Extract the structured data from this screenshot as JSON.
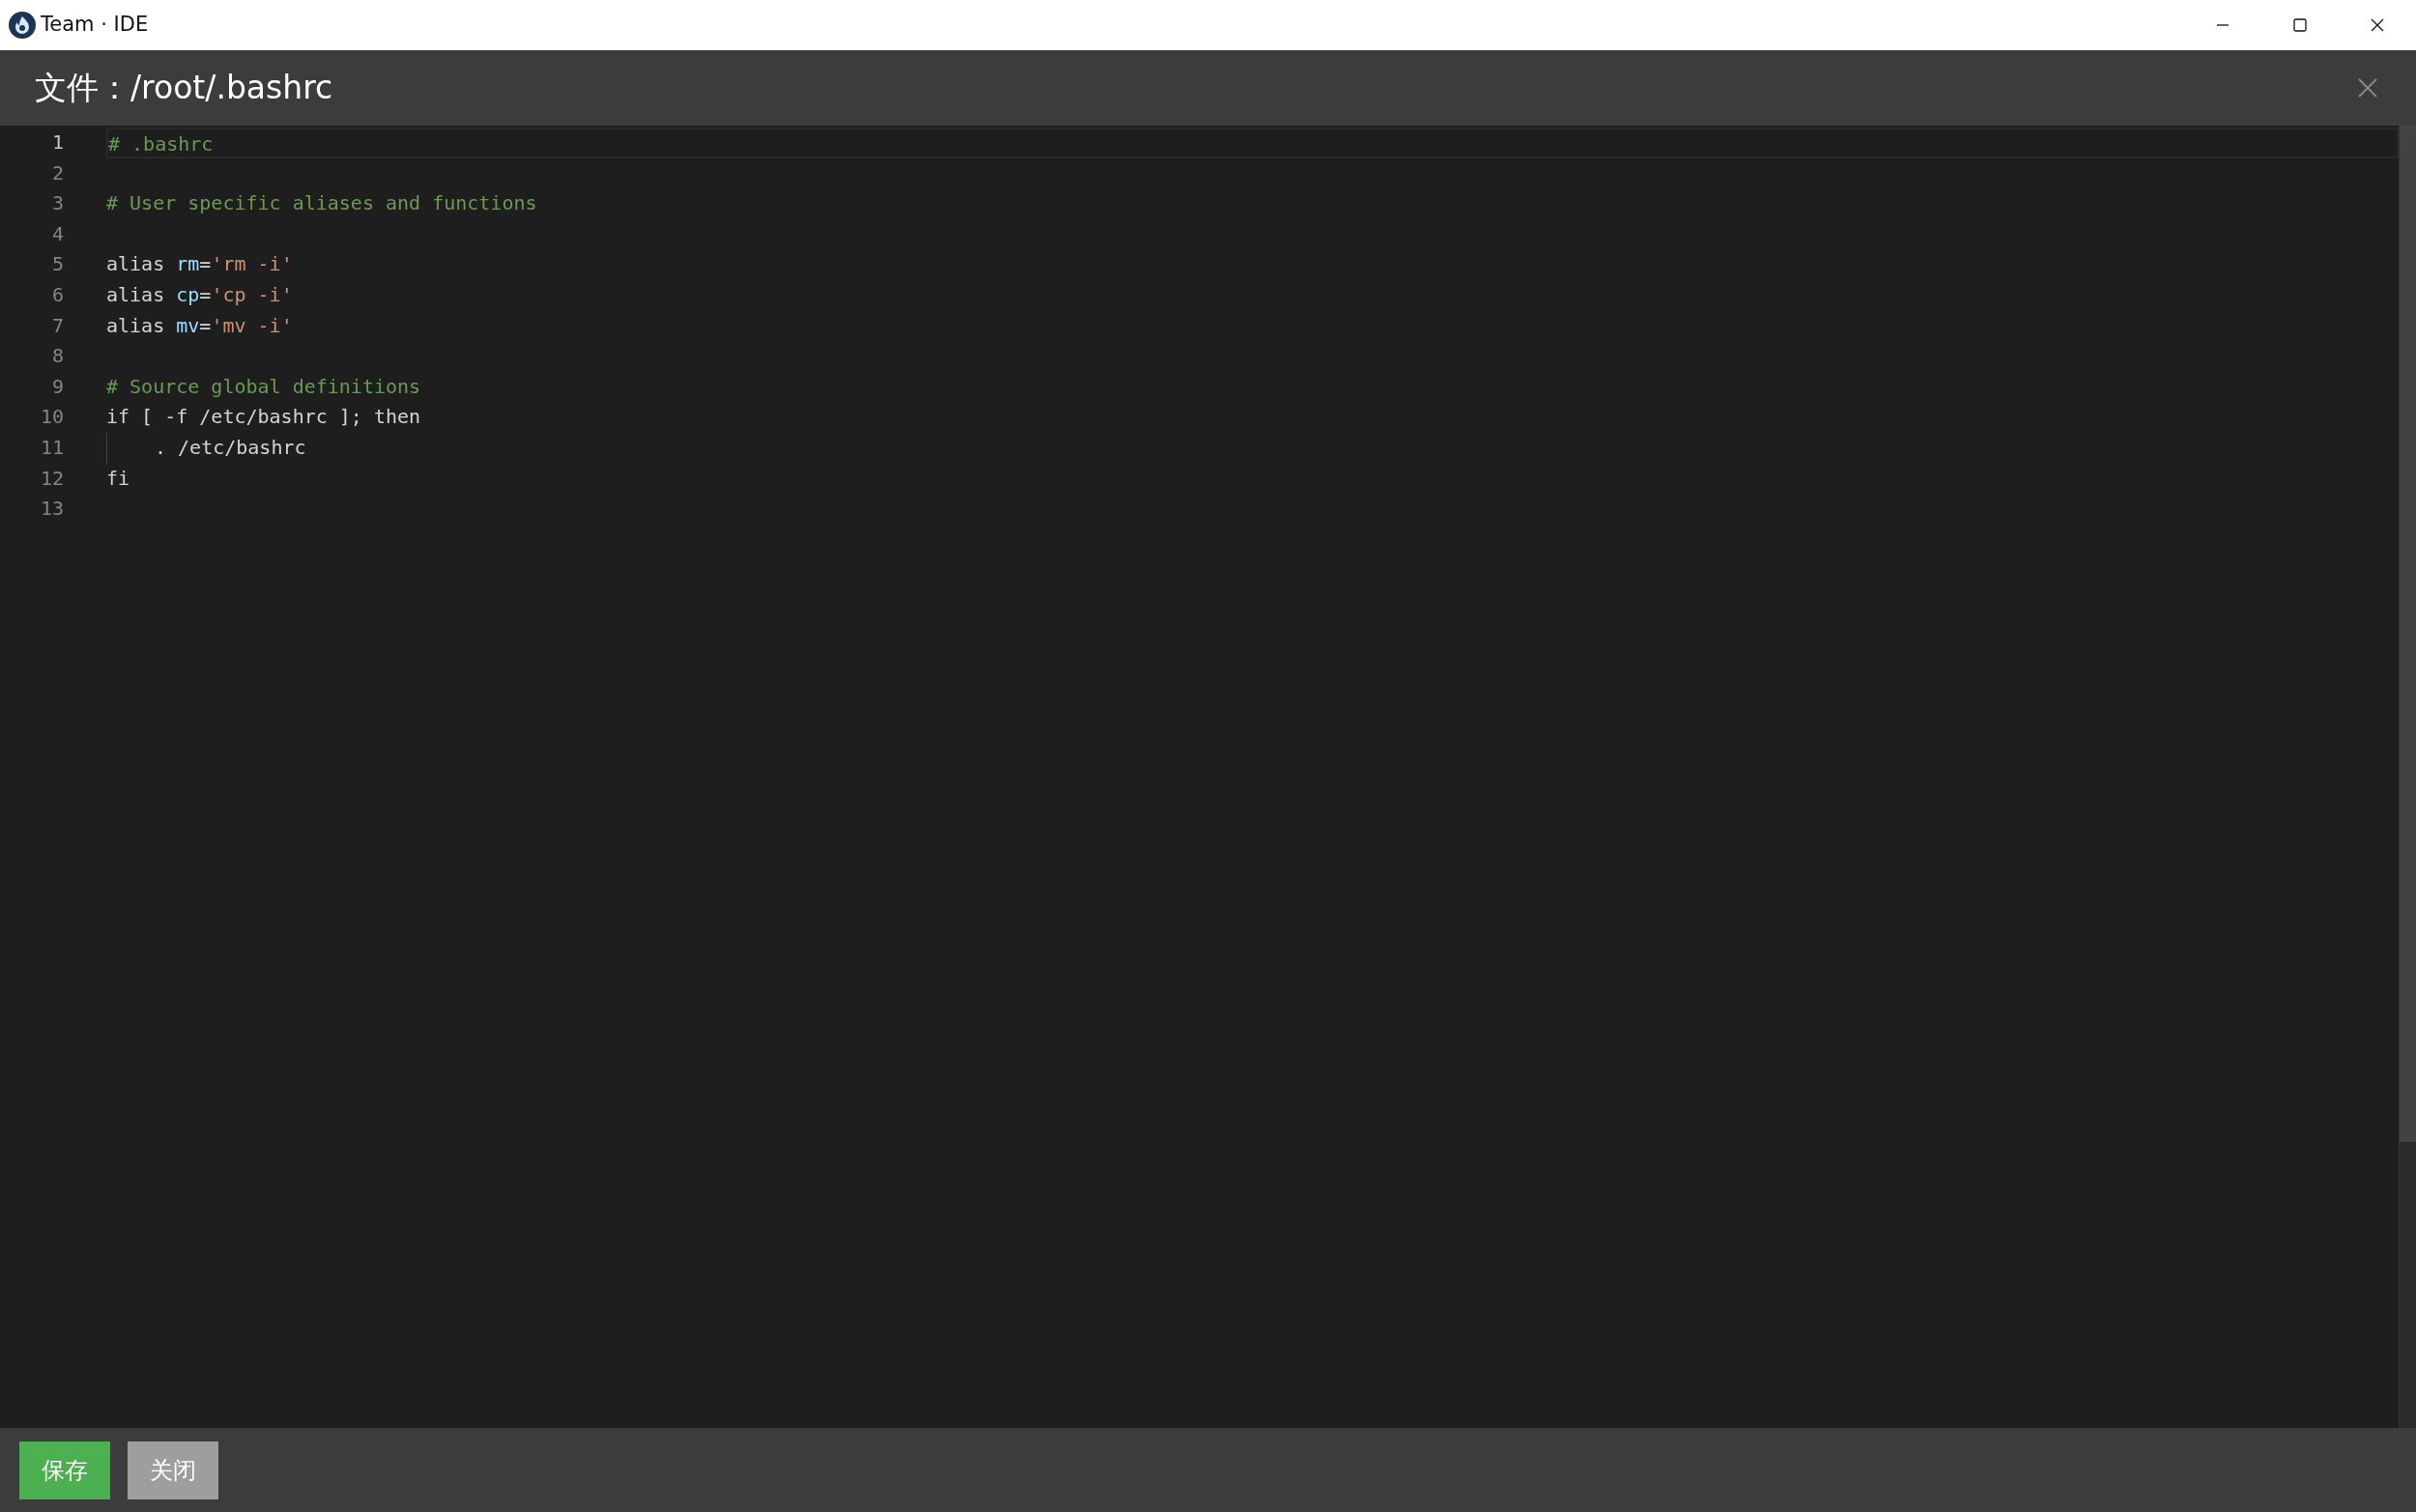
{
  "window": {
    "title": "Team · IDE"
  },
  "dialog": {
    "title": "文件：/root/.bashrc"
  },
  "editor": {
    "lines": [
      {
        "number": "1",
        "current": true,
        "tokens": [
          {
            "kind": "comment",
            "text": "# .bashrc"
          }
        ]
      },
      {
        "number": "2",
        "current": false
      },
      {
        "number": "3",
        "current": false,
        "tokens": [
          {
            "kind": "comment",
            "text": "# User specific aliases and functions"
          }
        ]
      },
      {
        "number": "4",
        "current": false
      },
      {
        "number": "5",
        "current": false,
        "tokens": [
          {
            "kind": "plain",
            "text": "alias "
          },
          {
            "kind": "variable",
            "text": "rm"
          },
          {
            "kind": "plain",
            "text": "="
          },
          {
            "kind": "string",
            "text": "'rm -i'"
          }
        ]
      },
      {
        "number": "6",
        "current": false,
        "tokens": [
          {
            "kind": "plain",
            "text": "alias "
          },
          {
            "kind": "variable",
            "text": "cp"
          },
          {
            "kind": "plain",
            "text": "="
          },
          {
            "kind": "string",
            "text": "'cp -i'"
          }
        ]
      },
      {
        "number": "7",
        "current": false,
        "tokens": [
          {
            "kind": "plain",
            "text": "alias "
          },
          {
            "kind": "variable",
            "text": "mv"
          },
          {
            "kind": "plain",
            "text": "="
          },
          {
            "kind": "string",
            "text": "'mv -i'"
          }
        ]
      },
      {
        "number": "8",
        "current": false
      },
      {
        "number": "9",
        "current": false,
        "tokens": [
          {
            "kind": "comment",
            "text": "# Source global definitions"
          }
        ]
      },
      {
        "number": "10",
        "current": false,
        "tokens": [
          {
            "kind": "plain",
            "text": "if [ -f /etc/bashrc ]; then"
          }
        ]
      },
      {
        "number": "11",
        "current": false,
        "indented": true,
        "tokens": [
          {
            "kind": "plain",
            "text": ". /etc/bashrc"
          }
        ]
      },
      {
        "number": "12",
        "current": false,
        "tokens": [
          {
            "kind": "plain",
            "text": "fi"
          }
        ]
      },
      {
        "number": "13",
        "current": false
      }
    ]
  },
  "buttons": [
    {
      "label": "保存",
      "kind": "primary"
    },
    {
      "label": "关闭",
      "kind": "secondary"
    }
  ]
}
